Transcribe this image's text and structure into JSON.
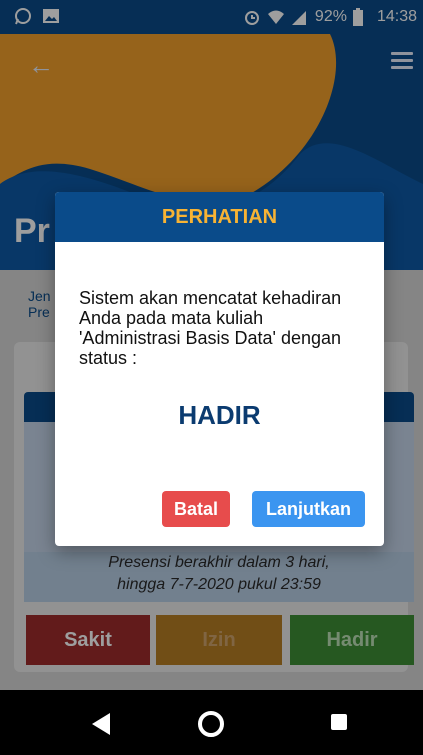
{
  "status_bar": {
    "battery": "92%",
    "time": "14:38"
  },
  "hero": {
    "title": "Pr"
  },
  "info_text": [
    "Jen",
    "Pre"
  ],
  "notice": {
    "line1": "Presensi berakhir dalam 3 hari,",
    "line2": "hingga 7-7-2020 pukul 23:59"
  },
  "attendance_buttons": {
    "sakit": "Sakit",
    "izin": "Izin",
    "hadir": "Hadir"
  },
  "dialog": {
    "title": "PERHATIAN",
    "message": "Sistem akan mencatat kehadiran Anda pada mata kuliah 'Administrasi Basis Data' dengan status :",
    "status": "HADIR",
    "cancel_label": "Batal",
    "continue_label": "Lanjutkan"
  },
  "colors": {
    "primary": "#0a4b8a",
    "accent_yellow": "#f7b334",
    "cancel": "#e74c4c",
    "continue": "#3b95f0"
  }
}
